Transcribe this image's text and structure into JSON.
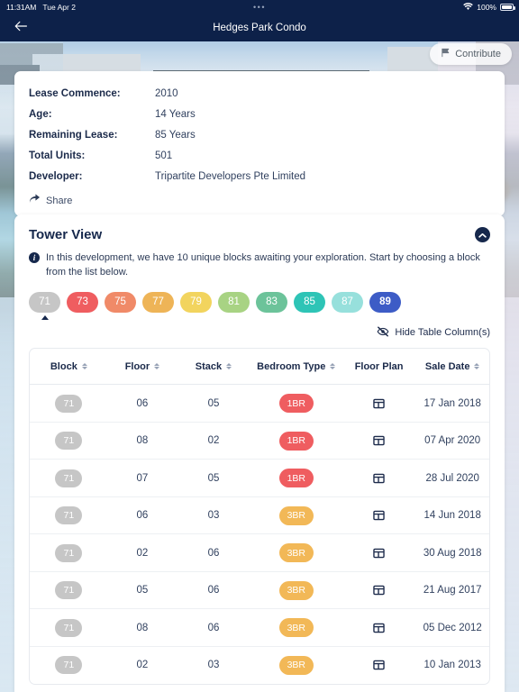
{
  "status_bar": {
    "time": "11:31AM",
    "date": "Tue Apr 2",
    "center_dots": "•••",
    "battery_pct": "100%",
    "wifi_icon": "wifi-icon",
    "battery_icon": "battery-full-icon"
  },
  "nav_bar": {
    "back_icon": "arrow-left-icon",
    "title": "Hedges Park Condo"
  },
  "hero": {
    "contribute_label": "Contribute",
    "contribute_icon": "flag-icon"
  },
  "info_card": {
    "rows": [
      {
        "label": "Lease Commence:",
        "value": "2010"
      },
      {
        "label": "Age:",
        "value": "14 Years"
      },
      {
        "label": "Remaining Lease:",
        "value": "85 Years"
      },
      {
        "label": "Total Units:",
        "value": "501"
      },
      {
        "label": "Developer:",
        "value": "Tripartite Developers Pte Limited"
      }
    ],
    "share_label": "Share",
    "share_icon": "share-arrow-icon"
  },
  "tower_view": {
    "title": "Tower View",
    "collapse_icon": "chevron-up-icon",
    "info_icon": "info-circle-icon",
    "note": "In this development, we have 10 unique blocks awaiting your exploration. Start by choosing a block from the list below.",
    "blocks": [
      {
        "label": "71",
        "color": "#c6c6c6",
        "selected": false
      },
      {
        "label": "73",
        "color": "#ef5d60",
        "selected": false
      },
      {
        "label": "75",
        "color": "#f08a68",
        "selected": false
      },
      {
        "label": "77",
        "color": "#eeb457",
        "selected": false
      },
      {
        "label": "79",
        "color": "#f2d45e",
        "selected": false
      },
      {
        "label": "81",
        "color": "#a8d383",
        "selected": false
      },
      {
        "label": "83",
        "color": "#6cc39a",
        "selected": false
      },
      {
        "label": "85",
        "color": "#2ec4b6",
        "selected": false
      },
      {
        "label": "87",
        "color": "#97e0dc",
        "selected": false
      },
      {
        "label": "89",
        "color": "#3d5cc6",
        "selected": true
      }
    ],
    "active_block": "71",
    "hide_columns_label": "Hide Table Column(s)",
    "hide_columns_icon": "eye-slash-icon"
  },
  "table": {
    "columns": [
      {
        "label": "Block",
        "sortable": true,
        "icon": "sort-icon"
      },
      {
        "label": "Floor",
        "sortable": true,
        "icon": "sort-icon"
      },
      {
        "label": "Stack",
        "sortable": true,
        "icon": "sort-icon"
      },
      {
        "label": "Bedroom Type",
        "sortable": true,
        "icon": "sort-icon"
      },
      {
        "label": "Floor Plan",
        "sortable": false,
        "icon": ""
      },
      {
        "label": "Sale Date",
        "sortable": true,
        "icon": "sort-icon"
      }
    ],
    "floor_plan_icon": "floor-plan-icon",
    "bedroom_colors": {
      "1BR": "#ef5d60",
      "3BR": "#f2b857"
    },
    "block_chip_color": "#c6c6c6",
    "rows": [
      {
        "block": "71",
        "floor": "06",
        "stack": "05",
        "bedroom": "1BR",
        "sale_date": "17 Jan 2018"
      },
      {
        "block": "71",
        "floor": "08",
        "stack": "02",
        "bedroom": "1BR",
        "sale_date": "07 Apr 2020"
      },
      {
        "block": "71",
        "floor": "07",
        "stack": "05",
        "bedroom": "1BR",
        "sale_date": "28 Jul 2020"
      },
      {
        "block": "71",
        "floor": "06",
        "stack": "03",
        "bedroom": "3BR",
        "sale_date": "14 Jun 2018"
      },
      {
        "block": "71",
        "floor": "02",
        "stack": "06",
        "bedroom": "3BR",
        "sale_date": "30 Aug 2018"
      },
      {
        "block": "71",
        "floor": "05",
        "stack": "06",
        "bedroom": "3BR",
        "sale_date": "21 Aug 2017"
      },
      {
        "block": "71",
        "floor": "08",
        "stack": "06",
        "bedroom": "3BR",
        "sale_date": "05 Dec 2012"
      },
      {
        "block": "71",
        "floor": "02",
        "stack": "03",
        "bedroom": "3BR",
        "sale_date": "10 Jan 2013"
      }
    ]
  },
  "theme": {
    "navy": "#0d2149",
    "card_bg": "#ffffff",
    "text_primary": "#1b2a4a",
    "text_secondary": "#31415f"
  }
}
